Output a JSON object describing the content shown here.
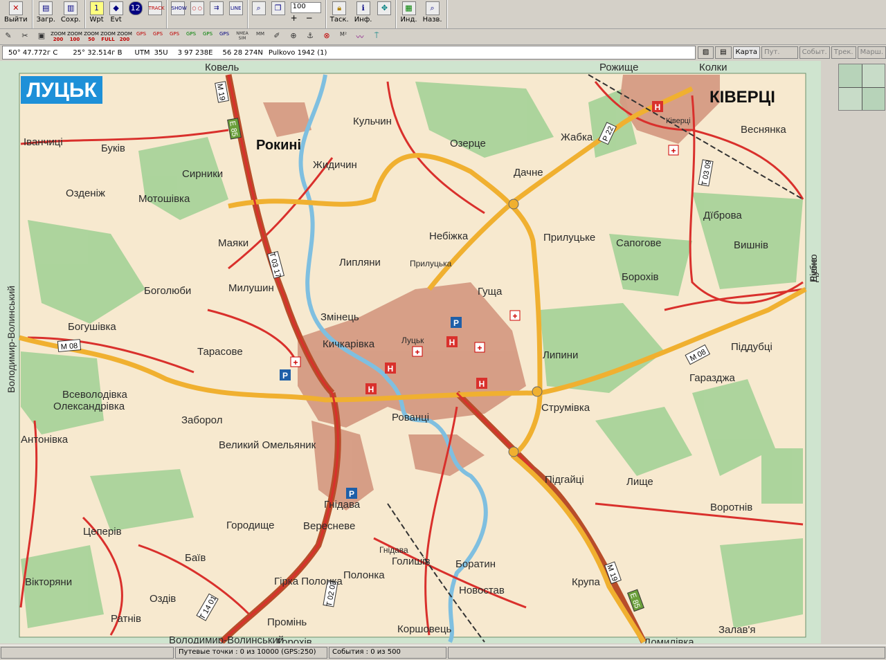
{
  "toolbar": {
    "exit_label": "Выйти",
    "load_label": "Загр.",
    "save_label": "Сохр.",
    "wpt_label": "Wpt",
    "evt_label": "Evt",
    "track_label": "TRACK",
    "show_label": "SHOW",
    "line_label": "LINE",
    "zoom_value": "100",
    "task_label": "Таск.",
    "info_label": "Инф.",
    "ind_label": "Инд.",
    "name_label": "Назв."
  },
  "toolbar2": {
    "zooms": [
      "200",
      "100",
      "50",
      "FULL",
      "200"
    ],
    "nmea_label": "NMEA SIM",
    "mm_label": "MM"
  },
  "coordbar": {
    "lat": "50° 47.772г С",
    "lon": "25° 32.514г В",
    "utm_label": "UTM",
    "utm_zone": "35U",
    "easting": "3 97 238E",
    "northing": "56 28 274N",
    "datum": "Pulkovo 1942 (1)"
  },
  "tabs": [
    "Карта",
    "Пут. точ.",
    "Событ.",
    "Трек.",
    "Марш."
  ],
  "status": {
    "waypoints": "Путевые точки : 0 из 10000  (GPS:250)",
    "events": "События : 0 из 500"
  },
  "map": {
    "title": "ЛУЦЬК",
    "towns": [
      "Рокині",
      "КІВЕРЦІ",
      "Ківерці"
    ],
    "places": [
      "Ковель",
      "Рожище",
      "Колки",
      "Іванчиці",
      "Буків",
      "Озденіж",
      "Сирники",
      "Мотошівка",
      "Жидичин",
      "Кульчин",
      "Озерце",
      "Жабка",
      "Дачне",
      "Веснянка",
      "Маяки",
      "Небіжка",
      "Прилуцьке",
      "Сапогове",
      "Дїброва",
      "Вишнів",
      "Липляни",
      "Прилуцька",
      "Гуща",
      "Борохів",
      "Боголюби",
      "Милушин",
      "Змінець",
      "Богушівка",
      "Кичкарівка",
      "Луцьк",
      "Липини",
      "Піддубці",
      "Тарасове",
      "Гаразджа",
      "Всеволодівка",
      "Олександрівка",
      "Заборол",
      "Рованці",
      "Струмівка",
      "Антонівка",
      "Великий Омельяник",
      "Підгайці",
      "Лище",
      "Гнідава",
      "Вересневе",
      "Воротнів",
      "Цеперів",
      "Городище",
      "Баїв",
      "Гнідава",
      "Голишів",
      "Боратин",
      "Вікторяни",
      "Гірка Полонка",
      "Полонка",
      "Новостав",
      "Крупа",
      "Оздів",
      "Ратнів",
      "Промінь",
      "Коршовець",
      "Залав'я",
      "Рівне",
      "Володимир-Волинський",
      "Горохів",
      "Домилівка",
      "Дубно"
    ],
    "road_labels": [
      "М 19",
      "Е 85",
      "Т 03 17",
      "М 08",
      "Т 03 09",
      "Р 22",
      "Т 14 01",
      "Т 02 03"
    ]
  }
}
